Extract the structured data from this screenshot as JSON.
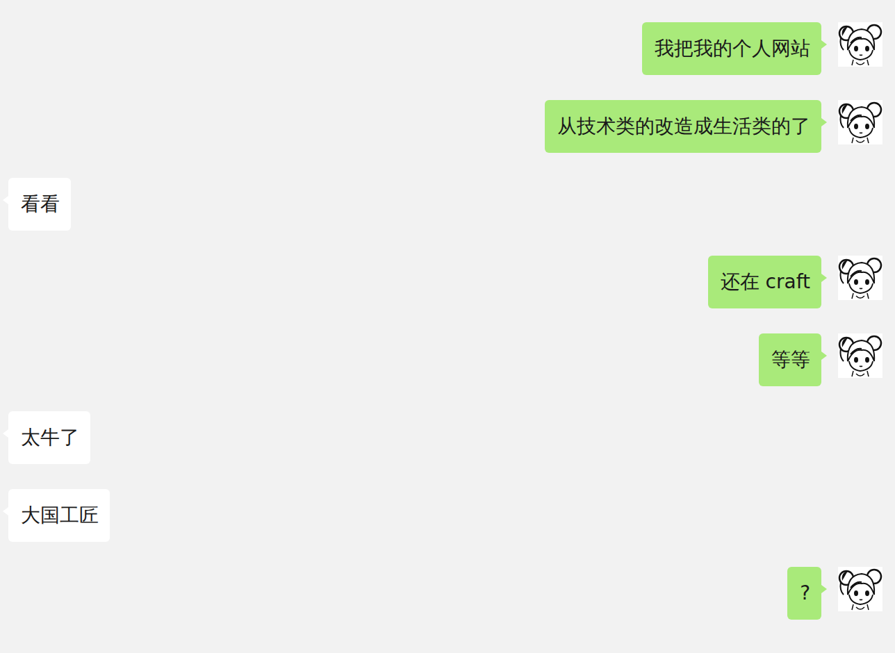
{
  "messages": [
    {
      "kind": "me",
      "text": "我把我的个人网站"
    },
    {
      "kind": "me",
      "text": "从技术类的改造成生活类的了"
    },
    {
      "kind": "other",
      "text": "看看"
    },
    {
      "kind": "me",
      "text": "还在 craft"
    },
    {
      "kind": "me",
      "text": "等等"
    },
    {
      "kind": "other",
      "text": "太牛了"
    },
    {
      "kind": "other",
      "text": "大国工匠"
    },
    {
      "kind": "me",
      "text": "?"
    }
  ]
}
